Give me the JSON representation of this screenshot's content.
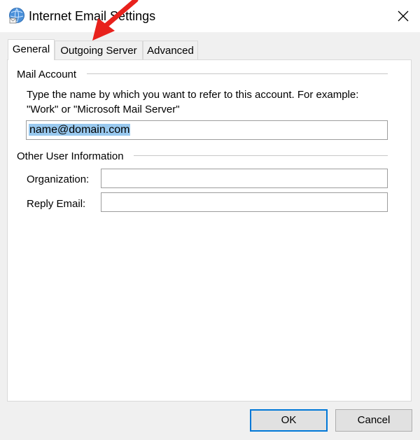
{
  "window": {
    "title": "Internet Email Settings",
    "icon": "internet-globe-icon",
    "close_icon": "close-icon"
  },
  "tabs": [
    {
      "label": "General",
      "active": true
    },
    {
      "label": "Outgoing Server",
      "active": false
    },
    {
      "label": "Advanced",
      "active": false
    }
  ],
  "mail_account": {
    "group_label": "Mail Account",
    "description_line1": "Type the name by which you want to refer to this account. For example:",
    "description_line2": "\"Work\" or \"Microsoft Mail Server\"",
    "account_name_value": "name@domain.com"
  },
  "other_user_info": {
    "group_label": "Other User Information",
    "organization_label": "Organization:",
    "organization_value": "",
    "reply_email_label": "Reply Email:",
    "reply_email_value": ""
  },
  "buttons": {
    "ok": "OK",
    "cancel": "Cancel"
  },
  "annotation": {
    "arrow_color": "#e8211c",
    "points_to": "Outgoing Server"
  },
  "colors": {
    "selection": "#99c9ef",
    "default_button_border": "#0078d7"
  }
}
